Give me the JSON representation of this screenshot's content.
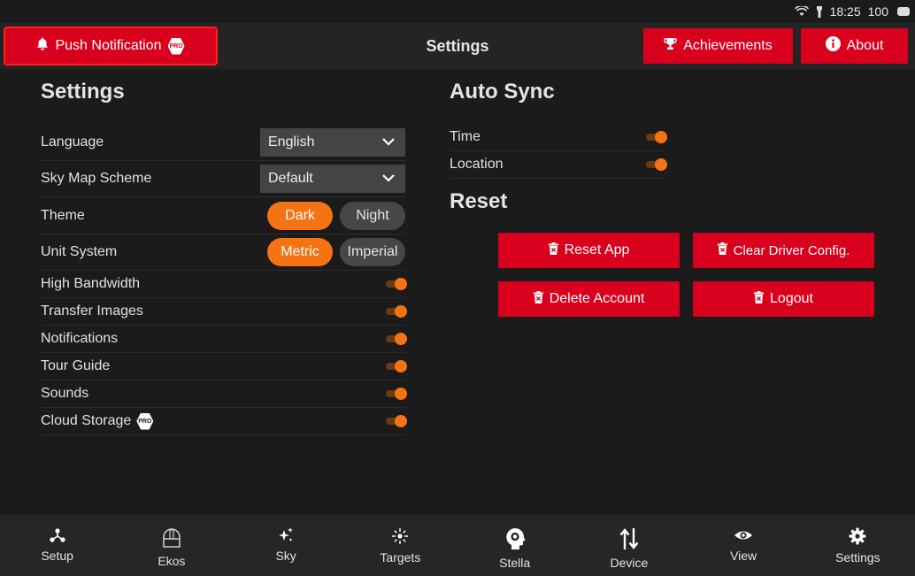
{
  "status_bar": {
    "time": "18:25",
    "battery": "100"
  },
  "header": {
    "push_label": "Push Notification",
    "pro_badge": "PRO",
    "title": "Settings",
    "achievements_label": "Achievements",
    "about_label": "About"
  },
  "settings": {
    "title": "Settings",
    "language": {
      "label": "Language",
      "value": "English"
    },
    "sky_map": {
      "label": "Sky Map Scheme",
      "value": "Default"
    },
    "theme": {
      "label": "Theme",
      "options": [
        "Dark",
        "Night"
      ],
      "selected": "Dark"
    },
    "unit": {
      "label": "Unit System",
      "options": [
        "Metric",
        "Imperial"
      ],
      "selected": "Metric"
    },
    "toggles": [
      {
        "label": "High Bandwidth",
        "on": true
      },
      {
        "label": "Transfer Images",
        "on": true
      },
      {
        "label": "Notifications",
        "on": true
      },
      {
        "label": "Tour Guide",
        "on": true
      },
      {
        "label": "Sounds",
        "on": true
      },
      {
        "label": "Cloud Storage",
        "on": true,
        "pro": "PRO"
      }
    ]
  },
  "auto_sync": {
    "title": "Auto Sync",
    "toggles": [
      {
        "label": "Time",
        "on": true
      },
      {
        "label": "Location",
        "on": true
      }
    ]
  },
  "reset": {
    "title": "Reset",
    "buttons": [
      "Reset App",
      "Clear Driver Config.",
      "Delete Account",
      "Logout"
    ]
  },
  "nav": [
    "Setup",
    "Ekos",
    "Sky",
    "Targets",
    "Stella",
    "Device",
    "View",
    "Settings"
  ],
  "colors": {
    "accent_red": "#d8001c",
    "accent_orange": "#f57312",
    "background": "#1b1b1b"
  }
}
